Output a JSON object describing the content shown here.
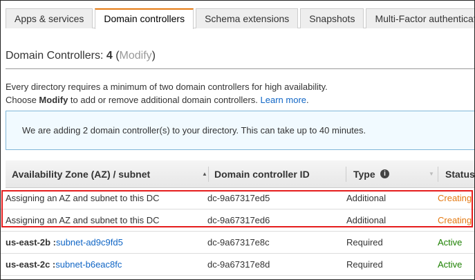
{
  "tabs": [
    "Apps & services",
    "Domain controllers",
    "Schema extensions",
    "Snapshots",
    "Multi-Factor authenticati"
  ],
  "title": {
    "label": "Domain Controllers:",
    "count": "4",
    "open": "(",
    "modify": "Modify",
    "close": ")"
  },
  "description": {
    "line1": "Every directory requires a minimum of two domain controllers for high availability.",
    "line2_pre": "Choose ",
    "line2_bold": "Modify",
    "line2_post": " to add or remove additional domain controllers. ",
    "learn_more": "Learn more",
    "period": "."
  },
  "info": "We are adding 2 domain controller(s) to your directory. This can take up to 40 minutes.",
  "table": {
    "headers": [
      "Availability Zone (AZ) / subnet",
      "Domain controller ID",
      "Type",
      "Status"
    ],
    "rows": [
      {
        "az": "Assigning an AZ and subnet to this DC",
        "subnet": "",
        "id": "dc-9a67317ed5",
        "type": "Additional",
        "status": "Creating"
      },
      {
        "az": "Assigning an AZ and subnet to this DC",
        "subnet": "",
        "id": "dc-9a67317ed6",
        "type": "Additional",
        "status": "Creating"
      },
      {
        "az": "us-east-2b :",
        "subnet": "subnet-ad9c9fd5",
        "id": "dc-9a67317e8c",
        "type": "Required",
        "status": "Active"
      },
      {
        "az": "us-east-2c :",
        "subnet": "subnet-b6eac8fc",
        "id": "dc-9a67317e8d",
        "type": "Required",
        "status": "Active"
      }
    ]
  },
  "colors": {
    "accent": "#e47911",
    "link": "#0f65c5",
    "creating": "#e47911",
    "active": "#1d8102",
    "highlight": "#e51c1c"
  }
}
